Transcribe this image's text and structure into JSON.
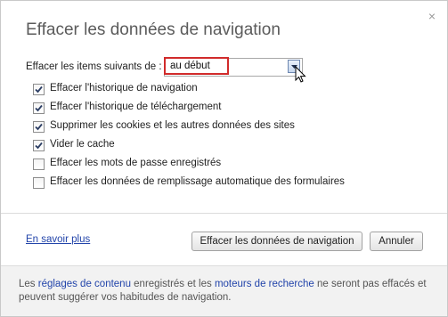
{
  "dialog": {
    "title": "Effacer les données de navigation",
    "close_symbol": "×"
  },
  "period": {
    "label": "Effacer les items suivants de :",
    "selected": "au début"
  },
  "options": [
    {
      "label": "Effacer l'historique de navigation",
      "checked": true
    },
    {
      "label": "Effacer l'historique de téléchargement",
      "checked": true
    },
    {
      "label": "Supprimer les cookies et les autres données des sites",
      "checked": true
    },
    {
      "label": "Vider le cache",
      "checked": true
    },
    {
      "label": "Effacer les mots de passe enregistrés",
      "checked": false
    },
    {
      "label": "Effacer les données de remplissage automatique des formulaires",
      "checked": false
    }
  ],
  "actions": {
    "learn_more": "En savoir plus",
    "clear_button": "Effacer les données de navigation",
    "cancel_button": "Annuler"
  },
  "footer": {
    "prefix": "Les ",
    "link1": "réglages de contenu",
    "middle": " enregistrés et les ",
    "link2": "moteurs de recherche",
    "suffix": " ne seront pas effacés et peuvent suggérer vos habitudes de navigation."
  },
  "colors": {
    "highlight": "#d12b2b",
    "link": "#2244aa"
  },
  "icons": {
    "close": "close-icon",
    "dropdown": "chevron-down-icon",
    "checkmark": "checkmark-icon",
    "cursor": "mouse-cursor-icon"
  }
}
